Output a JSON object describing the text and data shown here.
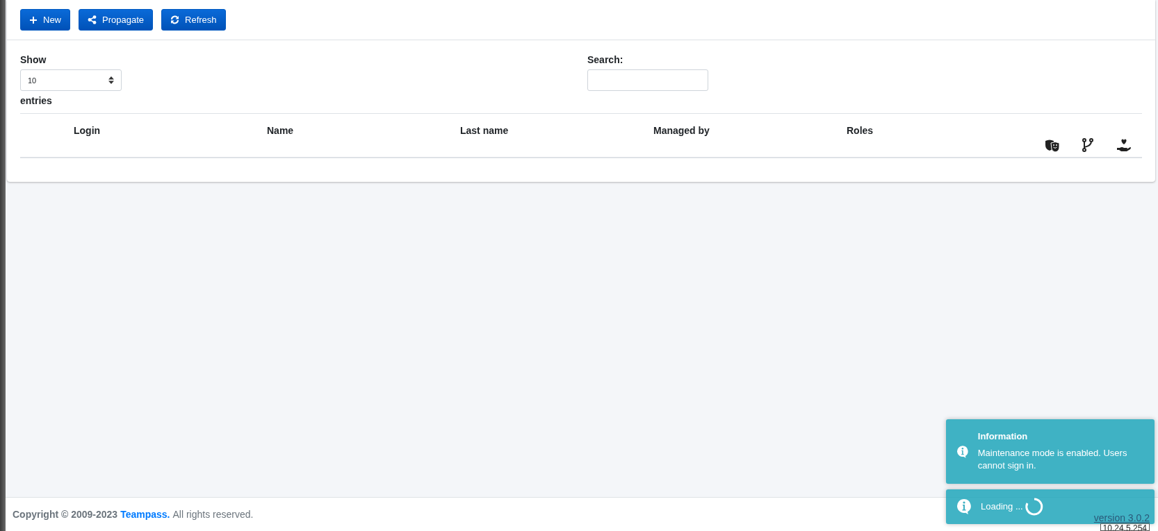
{
  "toolbar": {
    "buttons": [
      {
        "label": "New"
      },
      {
        "label": "Propagate"
      },
      {
        "label": "Refresh"
      }
    ]
  },
  "length_menu": {
    "label_before": "Show",
    "value": "10",
    "label_after": "entries"
  },
  "search": {
    "label": "Search:"
  },
  "table": {
    "columns": [
      {
        "kind": "text",
        "label": "Login"
      },
      {
        "kind": "text",
        "label": "Name"
      },
      {
        "kind": "text",
        "label": "Last name"
      },
      {
        "kind": "text",
        "label": "Managed by"
      },
      {
        "kind": "text",
        "label": "Roles"
      },
      {
        "kind": "icon"
      },
      {
        "kind": "icon"
      },
      {
        "kind": "icon"
      }
    ]
  },
  "toasts": [
    {
      "kind": "info",
      "title": "Information",
      "message": "Maintenance mode is enabled. Users cannot sign in."
    },
    {
      "kind": "loading",
      "message": "Loading ..."
    }
  ],
  "footer": {
    "copyright": "Copyright © 2009-2023",
    "link": "Teampass.",
    "rights": "All rights reserved.",
    "version": "version 3.0.2",
    "ip": "10.24.5.254"
  }
}
